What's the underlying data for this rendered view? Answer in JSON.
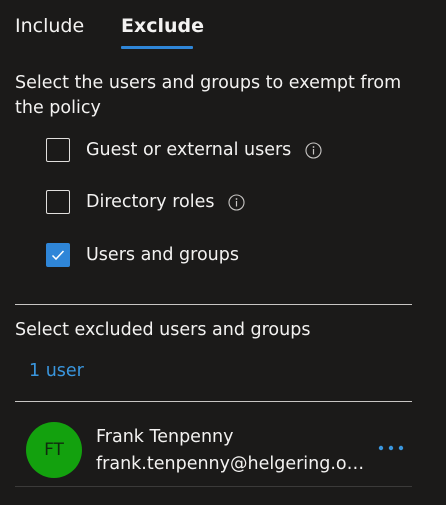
{
  "tabs": {
    "include_label": "Include",
    "exclude_label": "Exclude",
    "active": "Exclude"
  },
  "description": "Select the users and groups to exempt from the policy",
  "options": [
    {
      "label": "Guest or external users",
      "checked": false,
      "info_icon": "info-icon"
    },
    {
      "label": "Directory roles",
      "checked": false,
      "info_icon": "info-icon"
    },
    {
      "label": "Users and groups",
      "checked": true,
      "icon": "checkmark-icon"
    }
  ],
  "selected_section": {
    "title": "Select excluded users and groups",
    "count_link": "1 user"
  },
  "users": [
    {
      "initials": "FT",
      "name": "Frank Tenpenny",
      "email": "frank.tenpenny@helgering.onmicrosoft.com",
      "more_icon": "more-icon"
    }
  ],
  "colors": {
    "background": "#1b1a19",
    "accent": "#2f86d8",
    "link": "#3a96dd",
    "avatar": "#13a10e"
  }
}
